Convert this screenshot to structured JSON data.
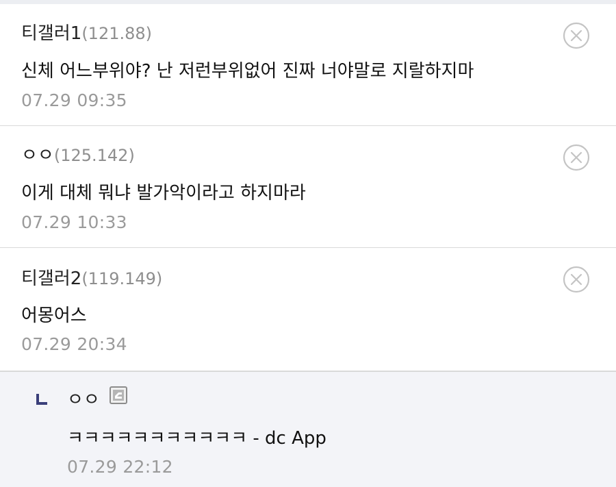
{
  "comments": [
    {
      "author": "티갤러1",
      "ip": "(121.88)",
      "body": "신체 어느부위야? 난 저런부위없어 진짜 너야말로 지랄하지마",
      "time": "07.29 09:35",
      "delete_icon": "close-circle-icon"
    },
    {
      "author": "ㅇㅇ",
      "ip": "(125.142)",
      "body": "이게 대체 뭐냐 발가악이라고 하지마라",
      "time": "07.29 10:33",
      "delete_icon": "close-circle-icon"
    },
    {
      "author": "티갤러2",
      "ip": "(119.149)",
      "body": "어몽어스",
      "time": "07.29 20:34",
      "delete_icon": "close-circle-icon"
    }
  ],
  "reply": {
    "arrow_icon": "reply-arrow-icon",
    "author": "ㅇㅇ",
    "badge_icon": "mobile-badge-icon",
    "body": "ㅋㅋㅋㅋㅋㅋㅋㅋㅋㅋㅋ - dc App",
    "time": "07.29 22:12"
  },
  "colors": {
    "reply_background": "#f3f4f8",
    "divider": "#d9d9d9",
    "reply_arrow": "#3a3f7a"
  }
}
